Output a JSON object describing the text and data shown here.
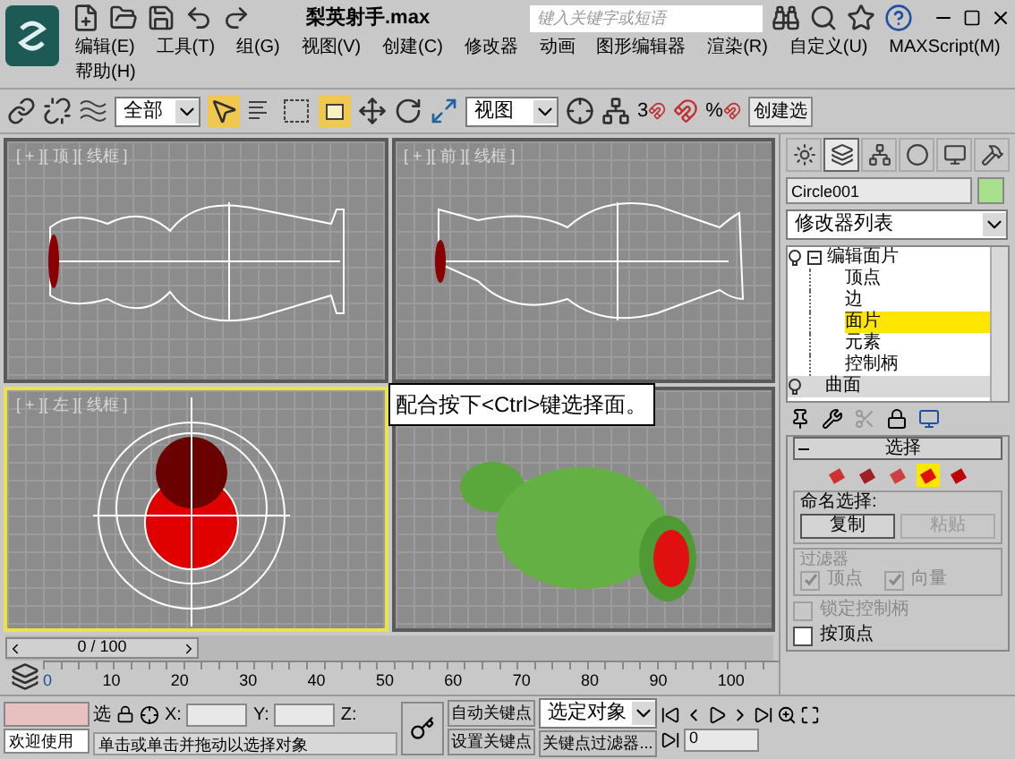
{
  "title_bar": {
    "filename": "梨英射手.max",
    "search_placeholder": "键入关键字或短语"
  },
  "menu": [
    "编辑(E)",
    "工具(T)",
    "组(G)",
    "视图(V)",
    "创建(C)",
    "修改器",
    "动画",
    "图形编辑器",
    "渲染(R)",
    "自定义(U)",
    "MAXScript(M)",
    "帮助(H)"
  ],
  "toolbar": {
    "selection_filter": "全部",
    "coord_system": "视图",
    "named_set": "创建选",
    "snap_labels": [
      "3",
      "%"
    ]
  },
  "viewports": [
    {
      "kind": "top",
      "label": "[ + ][ 顶 ][ 线框 ]",
      "selected": false
    },
    {
      "kind": "front",
      "label": "[ + ][ 前 ][ 线框 ]",
      "selected": false
    },
    {
      "kind": "left",
      "label": "[ + ][ 左 ][ 线框 ]",
      "selected": true
    },
    {
      "kind": "perspective",
      "selected": false
    }
  ],
  "callout": "配合按下<Ctrl>键选择面。",
  "command_panel": {
    "tabs": [
      {
        "kind": "create",
        "selected": false
      },
      {
        "kind": "modify",
        "selected": true
      },
      {
        "kind": "hierarchy",
        "selected": false
      },
      {
        "kind": "motion",
        "selected": false
      },
      {
        "kind": "display",
        "selected": false
      },
      {
        "kind": "utilities",
        "selected": false
      }
    ],
    "object_name": "Circle001",
    "modifier_list": "修改器列表",
    "stack": [
      {
        "label": "编辑面片",
        "expanded": true,
        "children": [
          {
            "label": "顶点",
            "selected": false
          },
          {
            "label": "边",
            "selected": false
          },
          {
            "label": "面片",
            "selected": true
          },
          {
            "label": "元素",
            "selected": false
          },
          {
            "label": "控制柄",
            "selected": false
          }
        ]
      },
      {
        "label": "曲面",
        "expanded": false
      }
    ],
    "rollout": {
      "title": "选择",
      "expanded": true,
      "subobjects": [
        {
          "kind": "vertex",
          "selected": false
        },
        {
          "kind": "edge",
          "selected": false
        },
        {
          "kind": "patch",
          "selected": false
        },
        {
          "kind": "element",
          "selected": true
        },
        {
          "kind": "handle",
          "selected": false
        }
      ],
      "named_selection": "命名选择:",
      "buttons": [
        {
          "label": "复制",
          "disabled": false
        },
        {
          "label": "粘贴",
          "disabled": true
        }
      ],
      "filter_title": "过滤器",
      "filters": [
        {
          "label": "顶点",
          "checked": true,
          "disabled": true
        },
        {
          "label": "向量",
          "checked": true,
          "disabled": true
        }
      ],
      "options": [
        {
          "label": "锁定控制柄",
          "checked": false,
          "disabled": true
        },
        {
          "label": "按顶点",
          "checked": false,
          "disabled": false
        }
      ]
    }
  },
  "timeline": {
    "position": "0 / 100",
    "level": 0,
    "ticks": [
      "0",
      "10",
      "20",
      "30",
      "40",
      "50",
      "60",
      "70",
      "80",
      "90",
      "100"
    ]
  },
  "status_bar": {
    "welcome": "欢迎使用",
    "selection_label": "选",
    "x_label": "X:",
    "y_label": "Y:",
    "z_label": "Z:",
    "prompt": "单击或单击并拖动以选择对象",
    "auto_key": "自动关键点",
    "set_key": "设置关键点",
    "key_mode": "选定对象",
    "key_filters": "关键点过滤器...",
    "frame": "0"
  }
}
